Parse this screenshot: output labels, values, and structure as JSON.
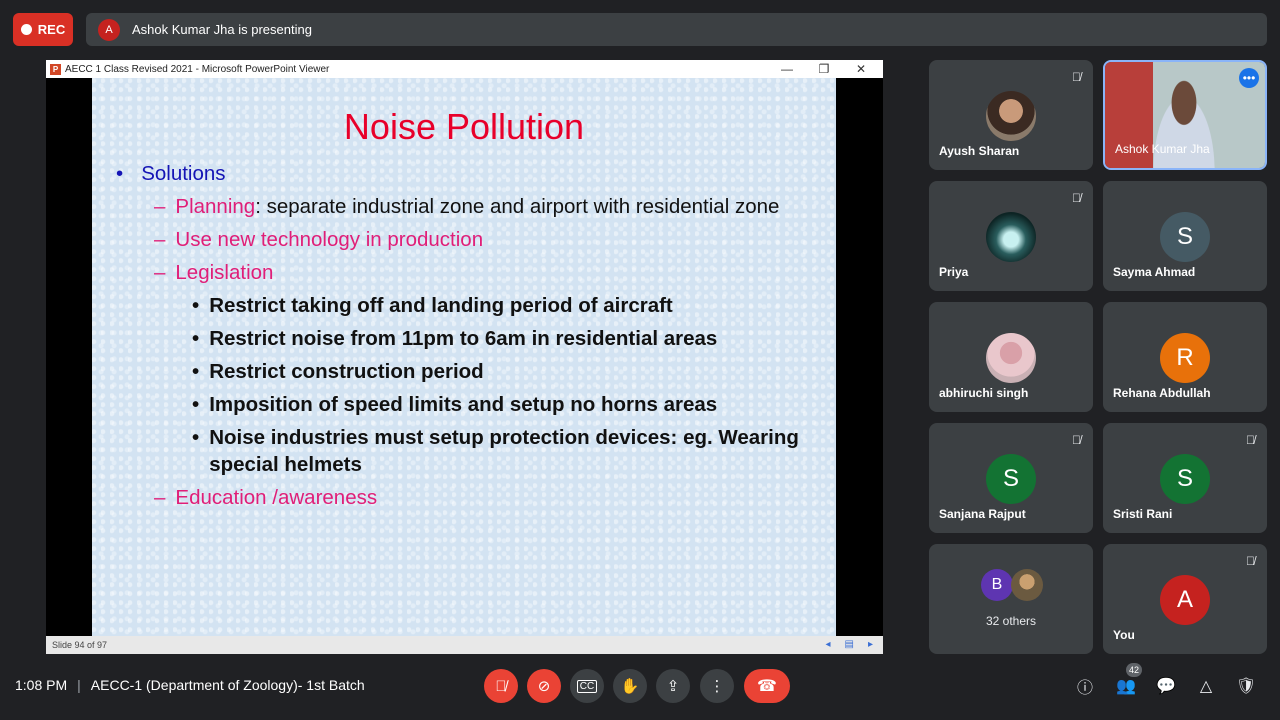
{
  "top": {
    "rec_label": "REC",
    "presenter_initial": "A",
    "presenting_text": "Ashok Kumar Jha is presenting"
  },
  "ppt": {
    "icon_letter": "P",
    "window_title": "AECC 1 Class Revised 2021 - Microsoft PowerPoint Viewer",
    "minimize": "—",
    "restore": "❐",
    "close": "✕",
    "slide_status": "Slide 94 of 97"
  },
  "slide": {
    "title": "Noise Pollution",
    "bullet_l1": "Solutions",
    "planning_label": "Planning",
    "planning_text": ": separate industrial zone and airport with residential zone",
    "item_tech": "Use new technology in production",
    "item_legislation": "Legislation",
    "sub_items": [
      "Restrict taking off and landing period of aircraft",
      "Restrict noise from 11pm to 6am in residential areas",
      "Restrict construction period",
      "Imposition of speed limits and setup no horns areas",
      "Noise industries must setup protection devices: eg. Wearing special helmets"
    ],
    "item_education": "Education /awareness"
  },
  "participants": [
    {
      "name": "Ayush Sharan"
    },
    {
      "name": "Ashok Kumar Jha"
    },
    {
      "name": "Priya"
    },
    {
      "name": "Sayma Ahmad",
      "initial": "S",
      "color": "#455a64"
    },
    {
      "name": "abhiruchi singh"
    },
    {
      "name": "Rehana Abdullah",
      "initial": "R",
      "color": "#e8710a"
    },
    {
      "name": "Sanjana Rajput",
      "initial": "S",
      "color": "#137333"
    },
    {
      "name": "Sristi Rani",
      "initial": "S",
      "color": "#137333"
    },
    {
      "others_initial": "B",
      "others_color": "#5e35b1",
      "label": "32 others"
    },
    {
      "name": "You",
      "initial": "A",
      "color": "#c5221f"
    }
  ],
  "bottom": {
    "time": "1:08 PM",
    "separator": "|",
    "meeting_name": "AECC-1 (Department of Zoology)- 1st Batch",
    "people_count": "42"
  }
}
